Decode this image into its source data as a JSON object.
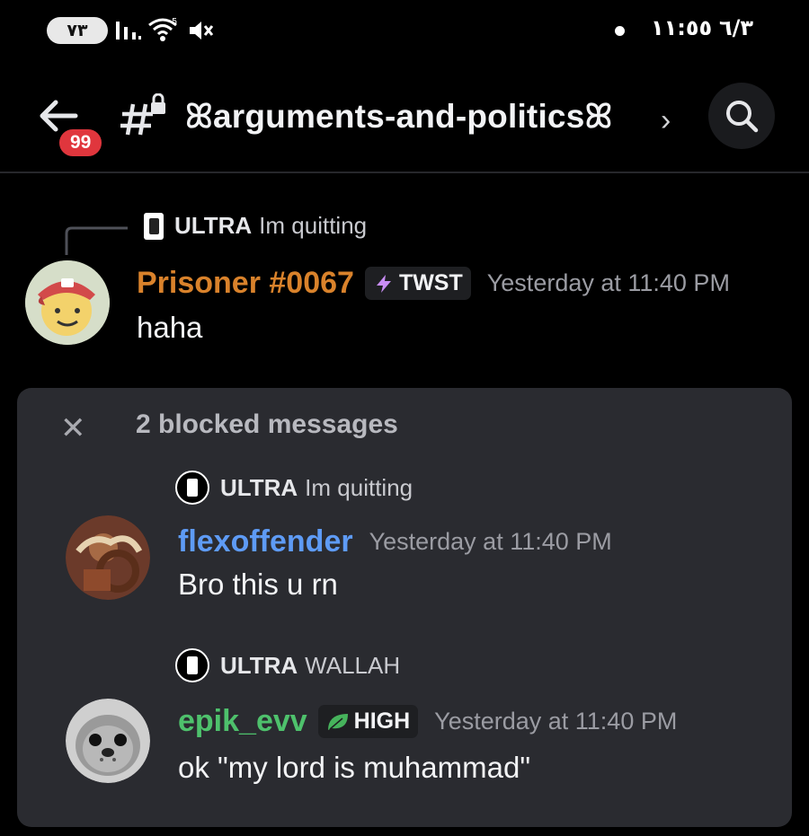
{
  "status_bar": {
    "battery": "٧٣",
    "time": "١١:٥٥",
    "date": "٦/٣"
  },
  "header": {
    "unread_count": "99",
    "channel_name": "ꕤarguments-and-politicsꕤ",
    "chevron": "›"
  },
  "first_message": {
    "reply": {
      "name": "ULTRA",
      "text": "Im quitting"
    },
    "author": "Prisoner #0067",
    "author_color": "#d9822b",
    "tag": "TWST",
    "timestamp": "Yesterday at 11:40 PM",
    "body": "haha"
  },
  "blocked_card": {
    "title": "2 blocked messages",
    "messages": [
      {
        "reply": {
          "name": "ULTRA",
          "text": "Im quitting"
        },
        "author": "flexoffender",
        "author_color": "#5e9bf5",
        "timestamp": "Yesterday at 11:40 PM",
        "body": "Bro this u rn"
      },
      {
        "reply": {
          "name": "ULTRA",
          "text": "WALLAH"
        },
        "author": "epik_evv",
        "author_color": "#4ec16c",
        "tag": "HIGH",
        "timestamp": "Yesterday at 11:40 PM",
        "body": "ok \"my lord is muhammad\""
      }
    ]
  }
}
